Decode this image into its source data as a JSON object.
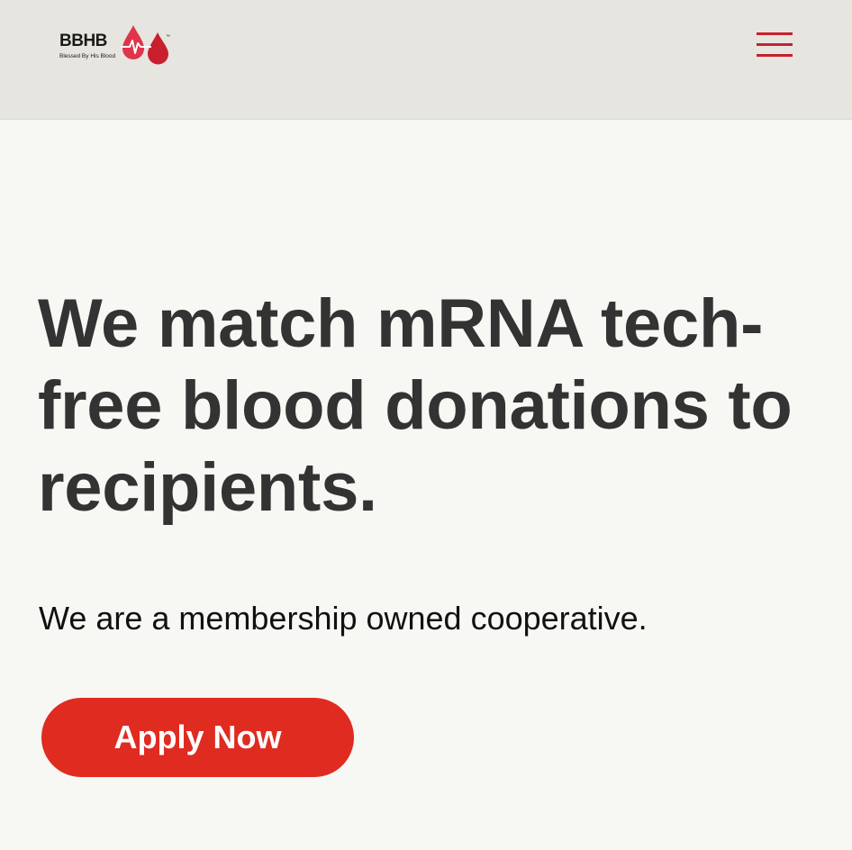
{
  "header": {
    "logo": {
      "wordmark": "BBHB",
      "tagline": "Blessed By His Blood",
      "trademark": "™",
      "icon": "blood-drops-heartbeat-icon"
    },
    "menu": {
      "icon": "hamburger-menu-icon"
    }
  },
  "hero": {
    "heading": "We match mRNA tech-free blood donations to recipients.",
    "subheading": "We are a membership owned cooperative.",
    "cta_label": "Apply Now"
  },
  "colors": {
    "header_background": "#e6e5df",
    "page_background": "#f7f7f3",
    "brand_red": "#e02b21",
    "logo_red": "#d42233",
    "heading_text": "#333333"
  }
}
